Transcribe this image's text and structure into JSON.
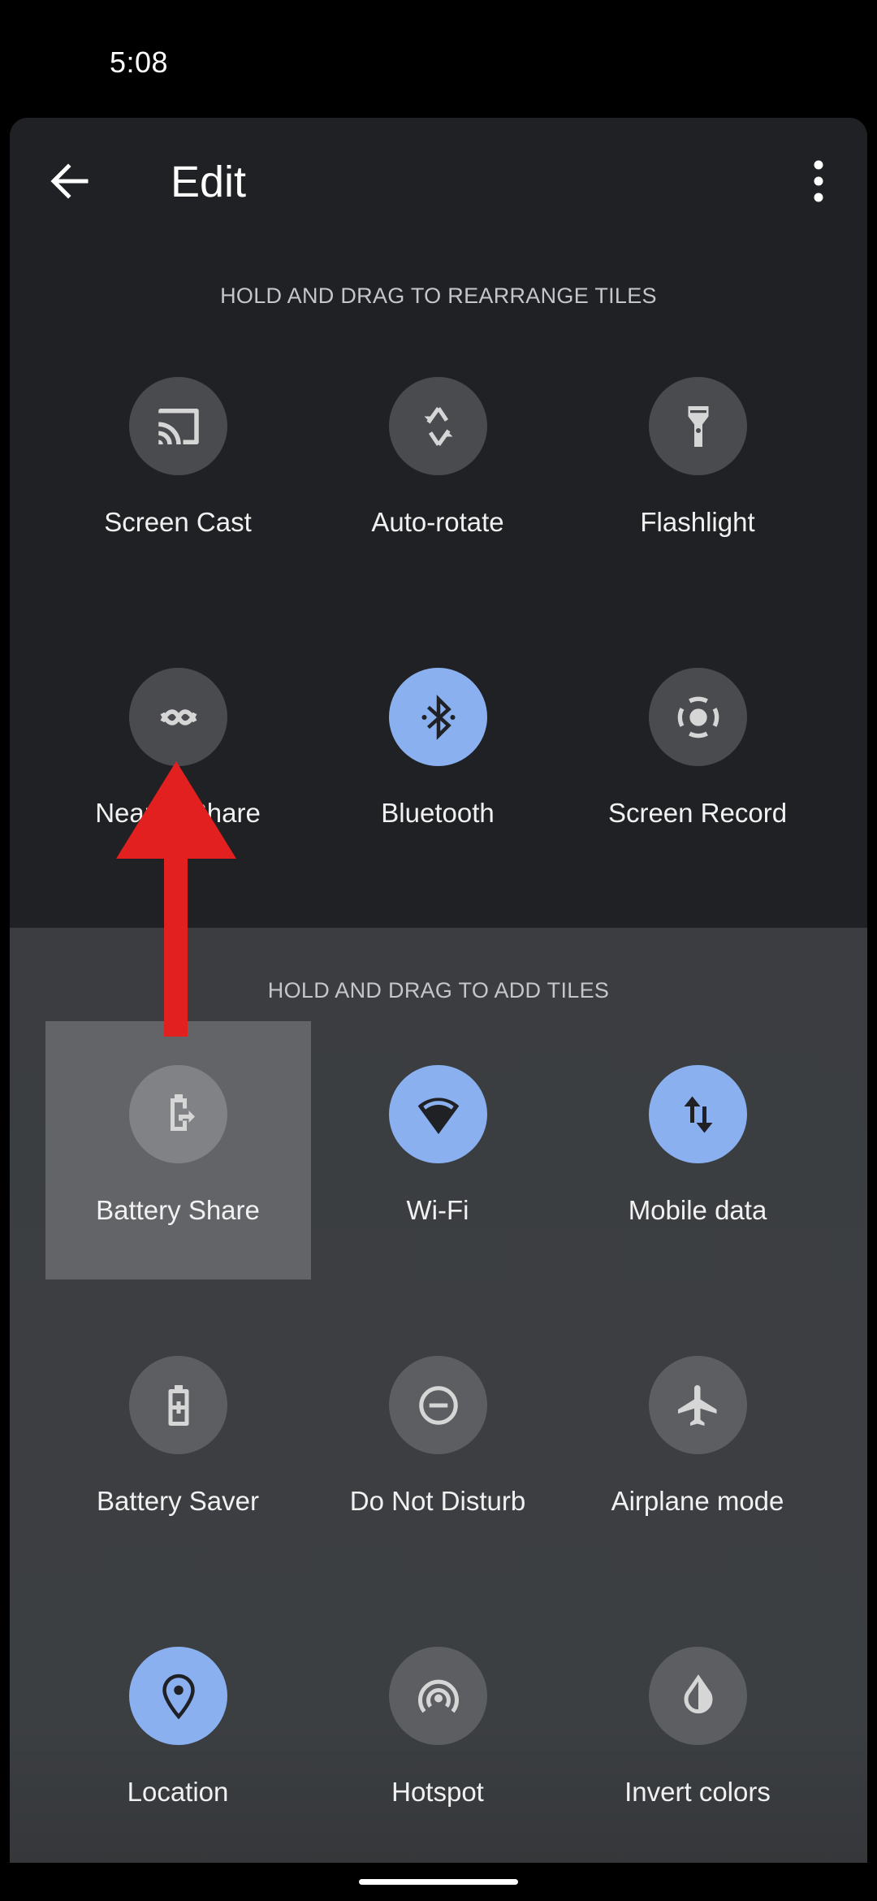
{
  "status_bar": {
    "time": "5:08"
  },
  "header": {
    "title": "Edit",
    "back_icon": "arrow-back-icon",
    "menu_icon": "more-vert-icon"
  },
  "current_tiles": {
    "heading": "HOLD AND DRAG TO REARRANGE TILES",
    "tiles": [
      {
        "label": "Screen Cast",
        "icon": "cast-icon",
        "active": false
      },
      {
        "label": "Auto-rotate",
        "icon": "auto-rotate-icon",
        "active": false
      },
      {
        "label": "Flashlight",
        "icon": "flashlight-icon",
        "active": false
      },
      {
        "label": "Nearby Share",
        "icon": "nearby-share-icon",
        "active": false
      },
      {
        "label": "Bluetooth",
        "icon": "bluetooth-icon",
        "active": true
      },
      {
        "label": "Screen Record",
        "icon": "screen-record-icon",
        "active": false
      }
    ]
  },
  "available_tiles": {
    "heading": "HOLD AND DRAG TO ADD TILES",
    "tiles": [
      {
        "label": "Battery Share",
        "icon": "battery-share-icon",
        "active": false,
        "selected": true
      },
      {
        "label": "Wi-Fi",
        "icon": "wifi-icon",
        "active": true
      },
      {
        "label": "Mobile data",
        "icon": "mobile-data-icon",
        "active": true
      },
      {
        "label": "Battery Saver",
        "icon": "battery-saver-icon",
        "active": false
      },
      {
        "label": "Do Not Disturb",
        "icon": "do-not-disturb-icon",
        "active": false
      },
      {
        "label": "Airplane mode",
        "icon": "airplane-icon",
        "active": false
      },
      {
        "label": "Location",
        "icon": "location-icon",
        "active": true
      },
      {
        "label": "Hotspot",
        "icon": "hotspot-icon",
        "active": false
      },
      {
        "label": "Invert colors",
        "icon": "invert-colors-icon",
        "active": false
      }
    ]
  },
  "annotation": {
    "type": "red-arrow",
    "meaning": "drag Battery Share up to current tiles",
    "color": "#e2201f"
  },
  "colors": {
    "accent": "#8ab0f0",
    "panel": "#202124",
    "add_area": "#3c3f42",
    "tile_off": "#4a4b4f"
  }
}
